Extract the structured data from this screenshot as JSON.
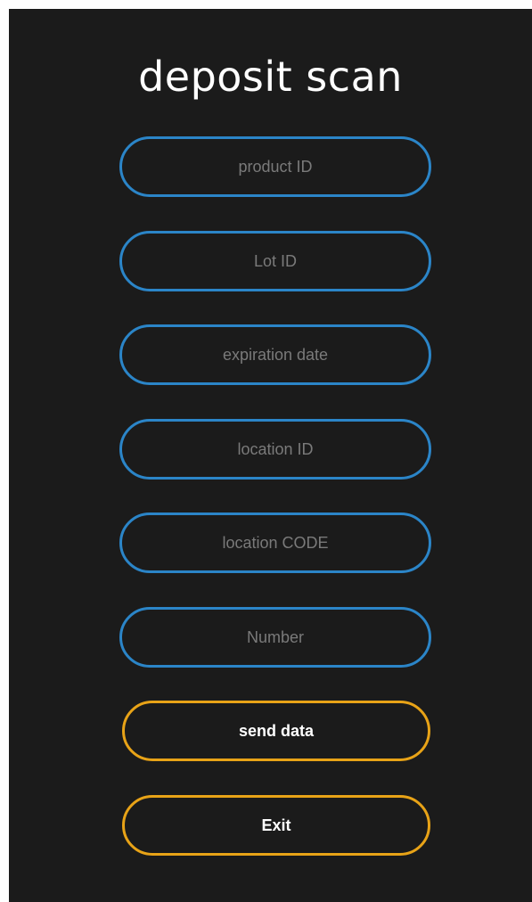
{
  "app": {
    "title": "deposit scan"
  },
  "form": {
    "fields": [
      {
        "placeholder": "product ID",
        "value": ""
      },
      {
        "placeholder": "Lot ID",
        "value": ""
      },
      {
        "placeholder": "expiration date",
        "value": ""
      },
      {
        "placeholder": "location ID",
        "value": ""
      },
      {
        "placeholder": "location CODE",
        "value": ""
      },
      {
        "placeholder": "Number",
        "value": ""
      }
    ]
  },
  "actions": {
    "send_label": "send data",
    "exit_label": "Exit"
  },
  "colors": {
    "background": "#1b1b1b",
    "field_border": "#2b85c8",
    "button_border": "#e8a317",
    "placeholder_text": "#7a7a7a",
    "title_text": "#ffffff"
  }
}
